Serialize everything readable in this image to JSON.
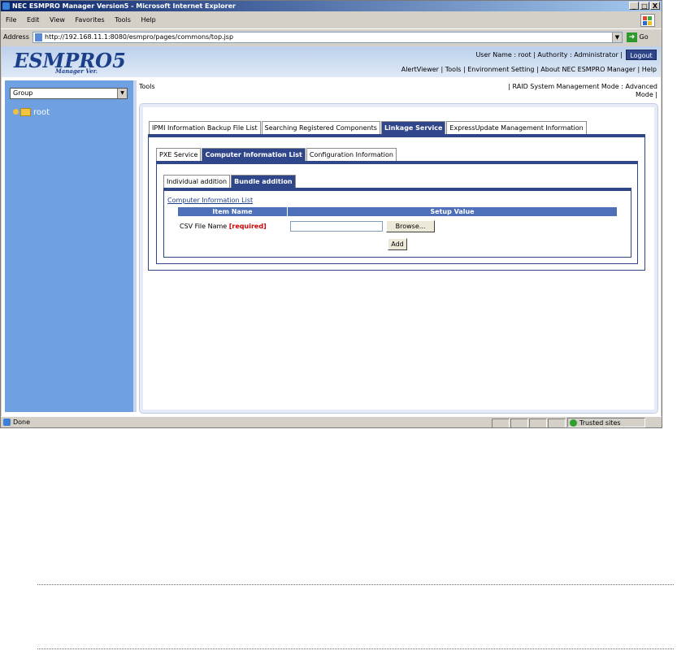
{
  "window": {
    "title": "NEC ESMPRO Manager Version5 - Microsoft Internet Explorer",
    "buttons": [
      "_",
      "□",
      "X"
    ]
  },
  "menu": [
    "File",
    "Edit",
    "View",
    "Favorites",
    "Tools",
    "Help"
  ],
  "address": {
    "label": "Address",
    "url": "http://192.168.11.1:8080/esmpro/pages/commons/top.jsp",
    "go": "Go"
  },
  "header": {
    "logo": "ESMPRO5",
    "logo_sub": "Manager Ver.",
    "user_line": "User Name :  root  | Authority : Administrator |",
    "logout": "Logout",
    "links": "AlertViewer  |  Tools  |  Environment Setting  |  About NEC ESMPRO Manager  |  Help"
  },
  "sidebar": {
    "group_select": "Group",
    "tree_root": "root"
  },
  "main": {
    "title": "Tools",
    "mode_line1": "| RAID System Management Mode : Advanced",
    "mode_line2": "Mode |",
    "tabs_level1": [
      "IPMI Information Backup File List",
      "Searching Registered Components",
      "Linkage Service",
      "ExpressUpdate Management Information"
    ],
    "tabs_level2": [
      "PXE Service",
      "Computer Information List",
      "Configuration Information"
    ],
    "tabs_level3": [
      "Individual addition",
      "Bundle addition"
    ],
    "section_link": "Computer Information List",
    "table_headers": [
      "Item Name",
      "Setup Value"
    ],
    "row_label": "CSV File Name",
    "row_required": "[required]",
    "browse_button": "Browse...",
    "add_button": "Add"
  },
  "status": {
    "text": "Done",
    "zone": "Trusted sites"
  },
  "colors": {
    "accent": "#30468a",
    "sidebar": "#6fa0e2",
    "required": "#cc0000"
  }
}
